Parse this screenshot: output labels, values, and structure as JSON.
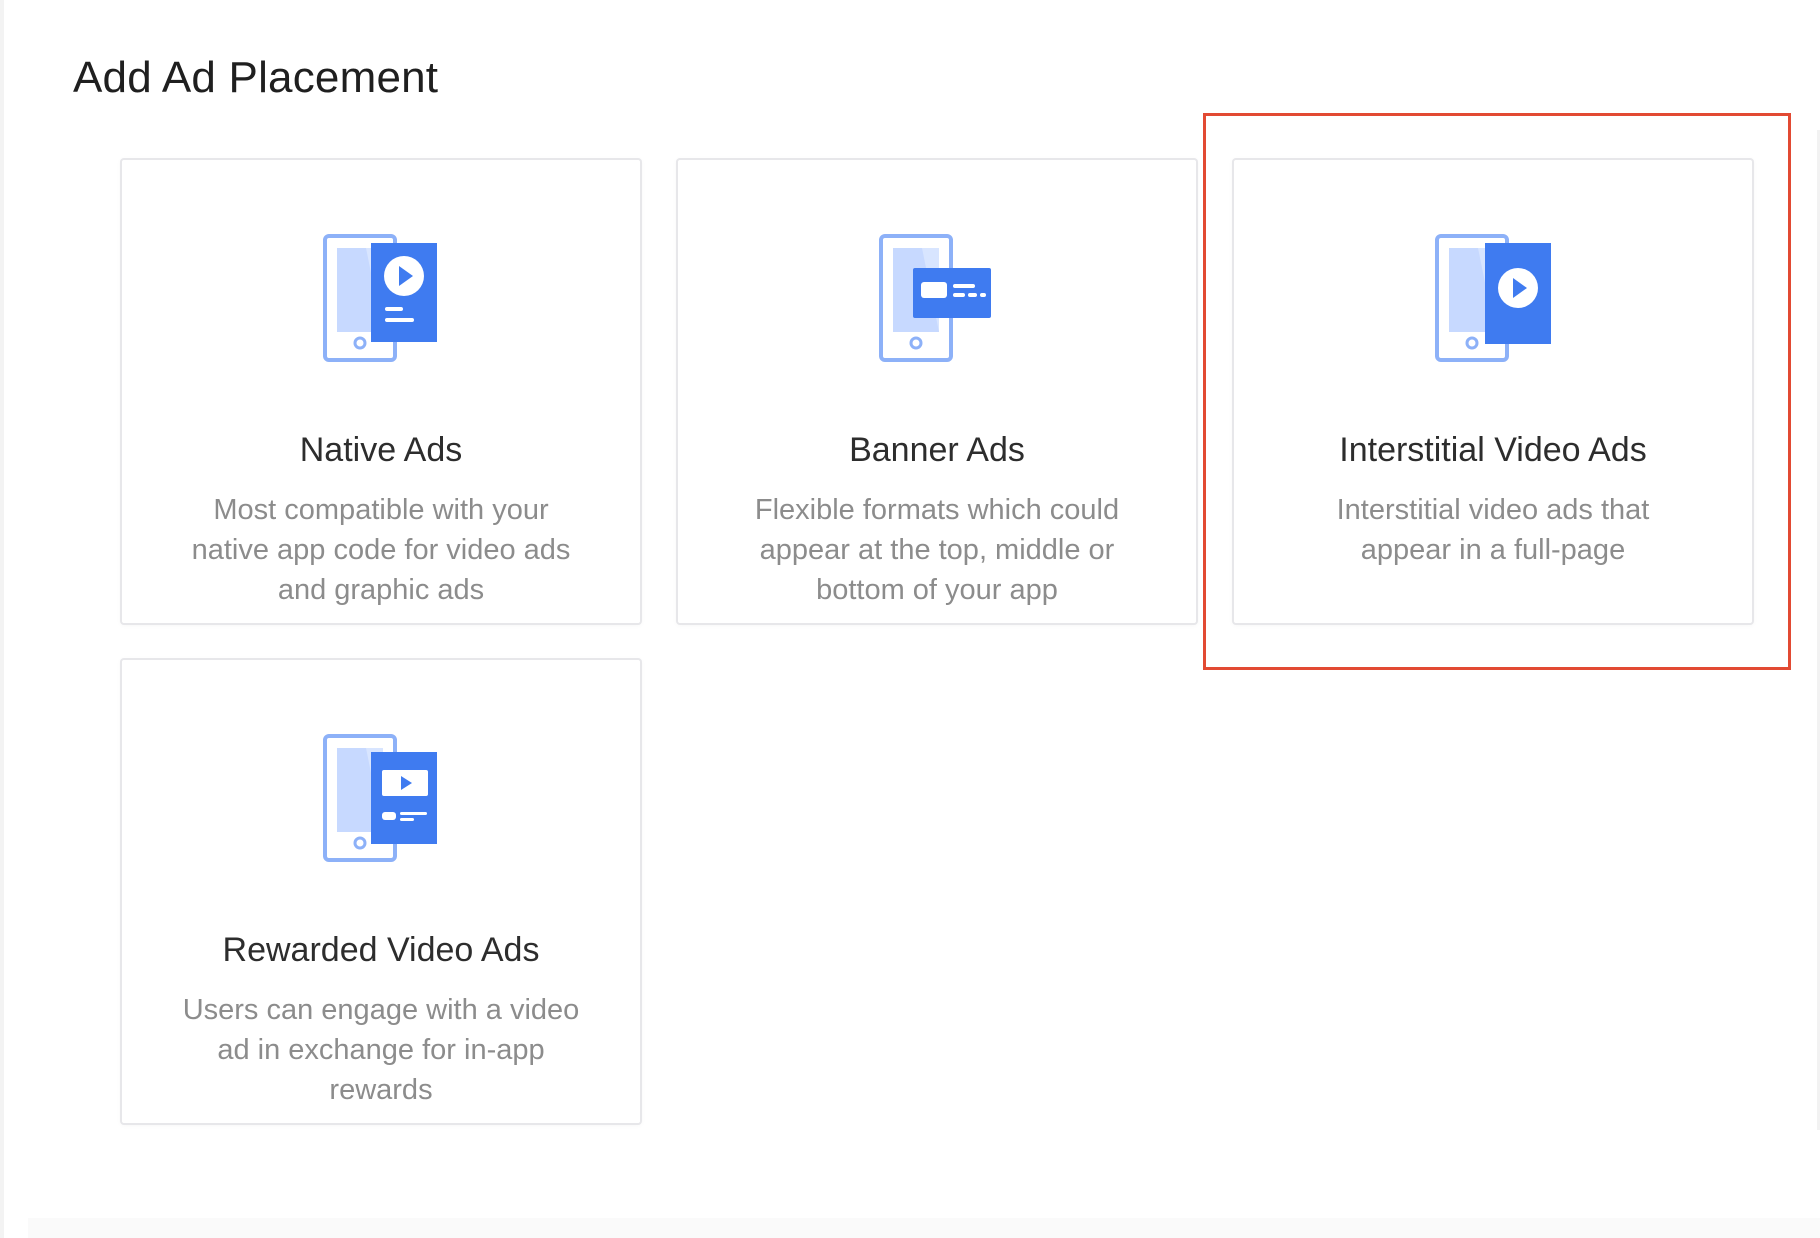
{
  "page": {
    "title": "Add Ad Placement"
  },
  "cards": [
    {
      "id": "native",
      "title": "Native Ads",
      "description": "Most compatible with your native app code for video ads and graphic ads",
      "icon": "native-ad-phone-icon"
    },
    {
      "id": "banner",
      "title": "Banner Ads",
      "description": "Flexible formats which could appear at the top, middle or bottom of your app",
      "icon": "banner-ad-phone-icon"
    },
    {
      "id": "interstitial",
      "title": "Interstitial Video Ads",
      "description": "Interstitial video ads that appear in a full-page",
      "icon": "interstitial-video-ad-phone-icon",
      "highlighted": true
    },
    {
      "id": "rewarded",
      "title": "Rewarded Video Ads",
      "description": "Users can engage with a video ad in exchange for in-app rewards",
      "icon": "rewarded-video-ad-phone-icon"
    }
  ],
  "colors": {
    "accent_blue": "#3f7bf0",
    "phone_outline": "#8db1f8",
    "phone_fill": "#c9daff",
    "highlight_border": "#e24a33"
  }
}
